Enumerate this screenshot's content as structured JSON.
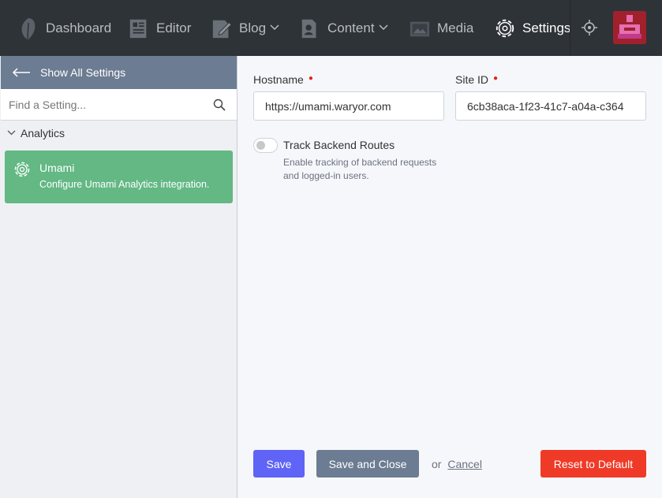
{
  "nav": {
    "items": [
      {
        "label": "Dashboard",
        "icon": "leaf-icon"
      },
      {
        "label": "Editor",
        "icon": "editor-icon"
      },
      {
        "label": "Blog",
        "icon": "blog-icon",
        "dropdown": true
      },
      {
        "label": "Content",
        "icon": "content-icon",
        "dropdown": true
      },
      {
        "label": "Media",
        "icon": "media-icon"
      },
      {
        "label": "Settings",
        "icon": "gear-icon",
        "active": true
      }
    ]
  },
  "sidebar": {
    "show_all_label": "Show All Settings",
    "search_placeholder": "Find a Setting...",
    "group_label": "Analytics",
    "setting": {
      "title": "Umami",
      "description": "Configure Umami Analytics integration."
    }
  },
  "form": {
    "hostname_label": "Hostname",
    "hostname_value": "https://umami.waryor.com",
    "siteid_label": "Site ID",
    "siteid_value": "6cb38aca-1f23-41c7-a04a-c364",
    "toggle_title": "Track Backend Routes",
    "toggle_help": "Enable tracking of backend requests and logged-in users.",
    "toggle_on": false
  },
  "actions": {
    "save": "Save",
    "save_close": "Save and Close",
    "or": "or",
    "cancel": "Cancel",
    "reset": "Reset to Default"
  },
  "colors": {
    "topbar": "#2e3338",
    "accent_green": "#63b884",
    "save_blue": "#5f63f6",
    "slate": "#6c7c92",
    "danger": "#f03a28"
  }
}
